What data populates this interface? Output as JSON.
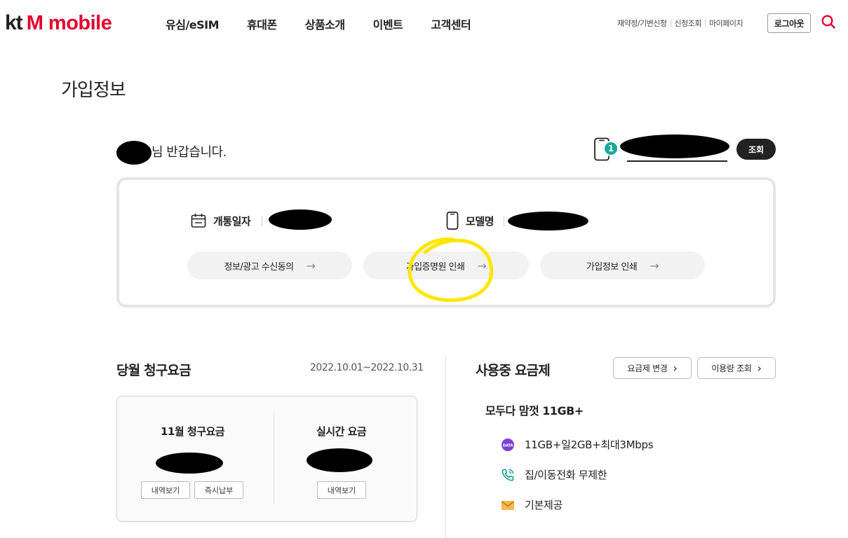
{
  "header": {
    "logo_kt": "kt",
    "logo_mobile": "M mobile",
    "nav": [
      "유심/eSIM",
      "휴대폰",
      "상품소개",
      "이벤트",
      "고객센터"
    ],
    "util_links": [
      "재약정/기변신청",
      "신청조회",
      "마이페이지"
    ],
    "logout_label": "로그아웃",
    "brand_color": "#e4002b"
  },
  "page": {
    "title": "가입정보"
  },
  "greeting": {
    "suffix": "님 반갑습니다.",
    "line_badge": "1",
    "lookup_label": "조회"
  },
  "info": {
    "open_date_label": "개통일자",
    "model_label": "모델명",
    "buttons": [
      "정보/광고 수신동의",
      "가입증명원 인쇄",
      "가입정보 인쇄"
    ],
    "arrow": "→"
  },
  "billing": {
    "title": "당월 청구요금",
    "period": "2022.10.01~2022.10.31",
    "monthly_label": "11월 청구요금",
    "realtime_label": "실시간 요금",
    "history_label": "내역보기",
    "pay_label": "즉시납부"
  },
  "plan": {
    "title": "사용중 요금제",
    "change_label": "요금제 변경",
    "usage_label": "이용량 조회",
    "chevron": "›",
    "name": "모두다 맘껏 11GB+",
    "features": [
      {
        "icon": "data-icon",
        "text": "11GB+일2GB+최대3Mbps"
      },
      {
        "icon": "phone-call-icon",
        "text": "집/이동전화 무제한"
      },
      {
        "icon": "envelope-icon",
        "text": "기본제공"
      }
    ]
  }
}
